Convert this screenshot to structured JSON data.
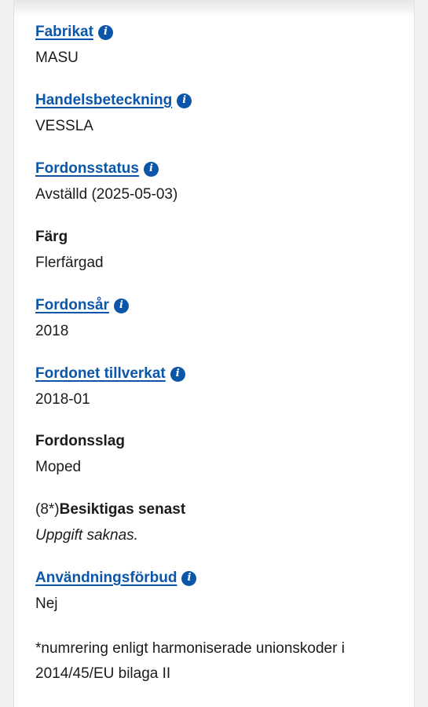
{
  "fields": [
    {
      "label": "Fabrikat",
      "value": "MASU",
      "link": true,
      "info": true
    },
    {
      "label": "Handelsbeteckning",
      "value": "VESSLA",
      "link": true,
      "info": true
    },
    {
      "label": "Fordonsstatus",
      "value": "Avställd (2025-05-03)",
      "link": true,
      "info": true
    },
    {
      "label": "Färg",
      "value": "Flerfärgad",
      "link": false,
      "info": false
    },
    {
      "label": "Fordonsår",
      "value": "2018",
      "link": true,
      "info": true
    },
    {
      "label": "Fordonet tillverkat",
      "value": "2018-01",
      "link": true,
      "info": true
    },
    {
      "label": "Fordonsslag",
      "value": "Moped",
      "link": false,
      "info": false
    },
    {
      "prefix": "(8*)",
      "label": "Besiktigas senast",
      "value": "Uppgift saknas.",
      "link": false,
      "info": false
    },
    {
      "label": "Användningsförbud",
      "value": "Nej",
      "link": true,
      "info": true
    }
  ],
  "footnote": "*numrering enligt harmoniserade unionskoder i 2014/45/EU bilaga II",
  "info_icon_symbol": "i",
  "colors": {
    "link": "#0b56a9",
    "text": "#1b1b1b"
  }
}
